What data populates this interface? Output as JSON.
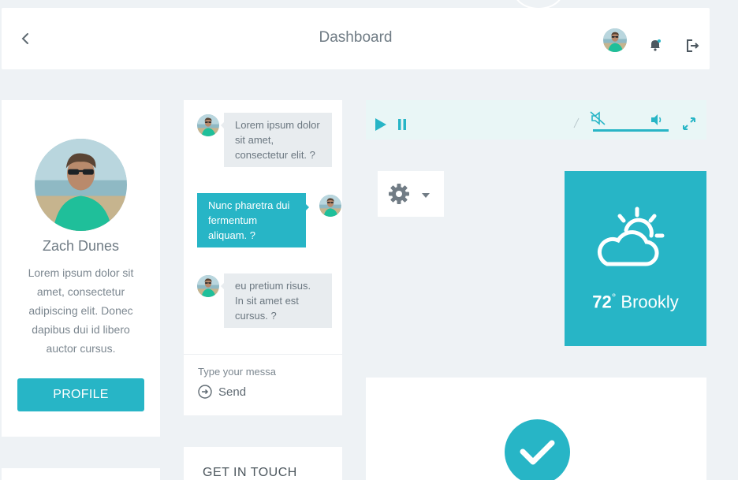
{
  "header": {
    "title": "Dashboard"
  },
  "profile": {
    "name": "Zach Dunes",
    "bio": "Lorem ipsum dolor sit amet, consectetur adipiscing elit. Donec dapibus dui id libero auctor cursus.",
    "button_label": "PROFILE"
  },
  "chat": {
    "messages": [
      {
        "text": "Lorem ipsum dolor sit amet, consectetur elit. ?",
        "direction": "incoming"
      },
      {
        "text": "Nunc pharetra dui fermentum aliquam. ?",
        "direction": "outgoing"
      },
      {
        "text": "eu pretium risus. In sit amet est cursus. ?",
        "direction": "incoming"
      }
    ],
    "input_placeholder": "Type your messa",
    "send_label": "Send"
  },
  "contact": {
    "title": "GET IN TOUCH"
  },
  "player": {
    "volume_level": 1.0
  },
  "weather": {
    "temperature": "72",
    "degree_symbol": "°",
    "city": "Brookly"
  },
  "colors": {
    "accent": "#27b5c6",
    "background": "#eef2f5",
    "player_bg": "#e9f6f6"
  },
  "icons": {
    "back": "chevron-left-icon",
    "bell": "bell-icon",
    "logout": "logout-icon",
    "play": "play-icon",
    "pause": "pause-icon",
    "mute": "mute-icon",
    "volume": "volume-icon",
    "fullscreen": "fullscreen-icon",
    "settings": "gear-icon",
    "weather": "partly-sunny-icon",
    "check": "check-icon",
    "send": "arrow-circle-right-icon"
  }
}
